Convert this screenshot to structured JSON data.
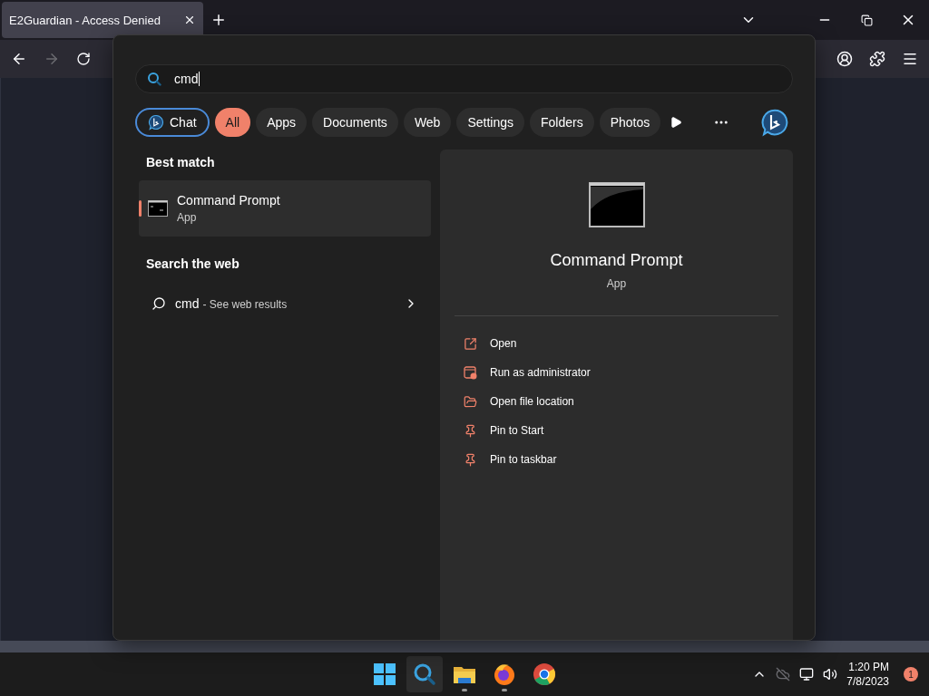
{
  "browser": {
    "tabs": [
      {
        "title": "E2Guardian - Access Denied",
        "selected": true
      }
    ],
    "forward_disabled": true
  },
  "search": {
    "query": "cmd",
    "filters": [
      {
        "label": "Chat",
        "kind": "chat",
        "selected": false
      },
      {
        "label": "All",
        "kind": "pill",
        "selected": true
      },
      {
        "label": "Apps",
        "kind": "pill",
        "selected": false
      },
      {
        "label": "Documents",
        "kind": "pill",
        "selected": false
      },
      {
        "label": "Web",
        "kind": "pill",
        "selected": false
      },
      {
        "label": "Settings",
        "kind": "pill",
        "selected": false
      },
      {
        "label": "Folders",
        "kind": "pill",
        "selected": false
      },
      {
        "label": "Photos",
        "kind": "pill",
        "selected": false
      }
    ],
    "best_match": {
      "heading": "Best match",
      "name": "Command Prompt",
      "type": "App",
      "selected": true
    },
    "web": {
      "heading": "Search the web",
      "query": "cmd",
      "suffix": "- See web results"
    },
    "preview": {
      "name": "Command Prompt",
      "type": "App",
      "actions": [
        {
          "label": "Open",
          "kind": "open"
        },
        {
          "label": "Run as administrator",
          "kind": "admin"
        },
        {
          "label": "Open file location",
          "kind": "folder"
        },
        {
          "label": "Pin to Start",
          "kind": "pin"
        },
        {
          "label": "Pin to taskbar",
          "kind": "pin"
        }
      ]
    }
  },
  "taskbar": {
    "apps": [
      {
        "kind": "start",
        "running": false,
        "selected": false
      },
      {
        "kind": "search",
        "running": false,
        "selected": true
      },
      {
        "kind": "explorer",
        "running": true,
        "selected": false
      },
      {
        "kind": "firefox",
        "running": true,
        "selected": false
      },
      {
        "kind": "chrome",
        "running": false,
        "selected": false
      }
    ],
    "time": "1:20 PM",
    "date": "7/8/2023",
    "notifications": "1"
  }
}
